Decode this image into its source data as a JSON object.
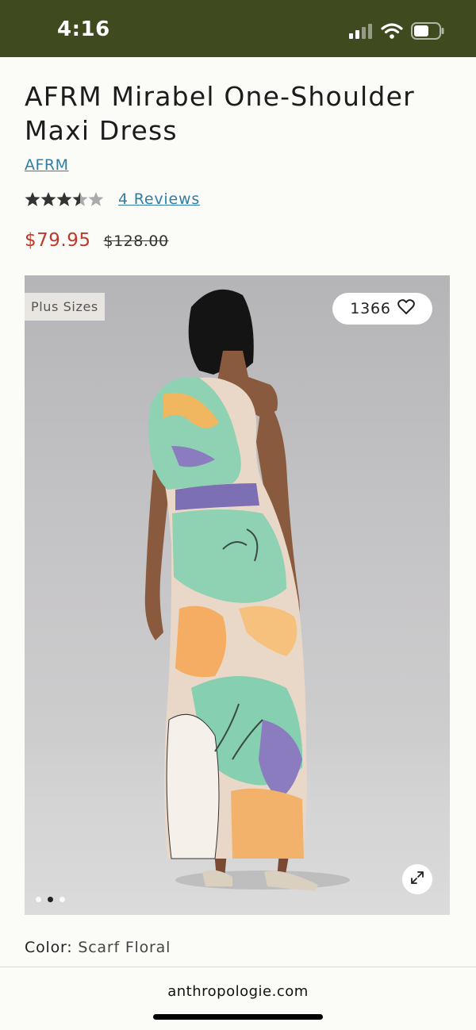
{
  "status_bar": {
    "time": "4:16",
    "icons": [
      "signal-icon",
      "wifi-icon",
      "battery-icon"
    ],
    "background": "#3f4a1f"
  },
  "product": {
    "title": "AFRM Mirabel One-Shoulder Maxi Dress",
    "brand": "AFRM",
    "rating": 3.5,
    "rating_max": 5,
    "reviews_label": "4 Reviews",
    "sale_price": "$79.95",
    "original_price": "$128.00",
    "sale_color": "#c0392b",
    "link_color": "#2f7ea6"
  },
  "gallery": {
    "badge": "Plus Sizes",
    "favorites_count": "1366",
    "image_count": 3,
    "active_image": 2,
    "expand_icon": "expand-icon",
    "favorite_icon": "heart-icon"
  },
  "options": {
    "color_label": "Color:",
    "color_value": "Scarf Floral"
  },
  "browser": {
    "url": "anthropologie.com"
  }
}
